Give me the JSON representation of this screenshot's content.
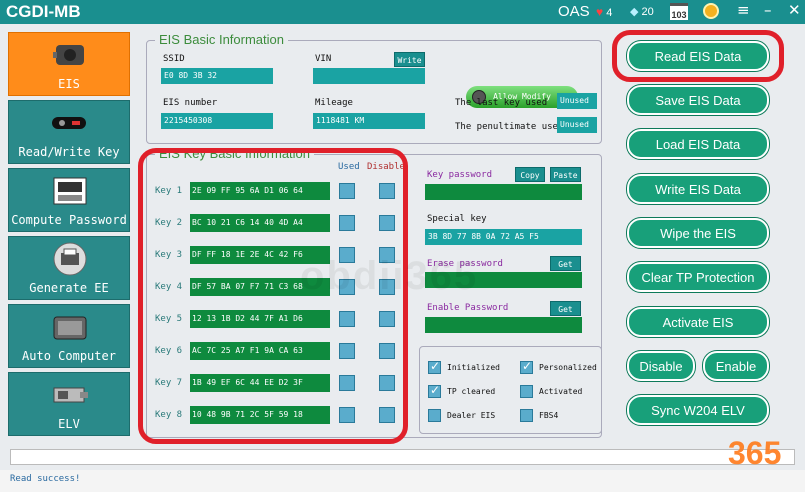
{
  "app": {
    "title": "CGDI-MB",
    "oas": "OAS",
    "hearts": "4",
    "diamonds": "20",
    "calendar": "103"
  },
  "sidebar": {
    "items": [
      {
        "label": "EIS",
        "icon": "eis-icon",
        "active": true
      },
      {
        "label": "Read/Write Key",
        "icon": "car-key-icon"
      },
      {
        "label": "Compute Password",
        "icon": "keyboard-icon"
      },
      {
        "label": "Generate EE",
        "icon": "printer-icon"
      },
      {
        "label": "Auto Computer",
        "icon": "ecu-icon"
      },
      {
        "label": "ELV",
        "icon": "elv-icon"
      }
    ]
  },
  "eis_basic": {
    "title": "EIS Basic Information",
    "ssid_label": "SSID",
    "ssid": "E0 8D 3B 32",
    "vin_label": "VIN",
    "vin": "",
    "write_label": "Write",
    "allow_modify": "Allow Modify",
    "eis_number_label": "EIS number",
    "eis_number": "2215450308",
    "mileage_label": "Mileage",
    "mileage": "1118481 KM",
    "last_key_label": "The last key used",
    "last_key": "Unused",
    "penultimate_label": "The penultimate used",
    "penultimate": "Unused"
  },
  "eis_key": {
    "title": "EIS Key Basic Information",
    "used_header": "Used",
    "disable_header": "Disable",
    "keys": [
      {
        "label": "Key 1",
        "value": "2E 09 FF 95 6A D1 06 64"
      },
      {
        "label": "Key 2",
        "value": "BC 10 21 C6 14 40 4D A4"
      },
      {
        "label": "Key 3",
        "value": "DF FF 18 1E 2E 4C 42 F6"
      },
      {
        "label": "Key 4",
        "value": "DF 57 BA 07 F7 71 C3 68"
      },
      {
        "label": "Key 5",
        "value": "12 13 1B D2 44 7F A1 D6"
      },
      {
        "label": "Key 6",
        "value": "AC 7C 25 A7 F1 9A CA 63"
      },
      {
        "label": "Key 7",
        "value": "1B 49 EF 6C 44 EE D2 3F"
      },
      {
        "label": "Key 8",
        "value": "10 48 9B 71 2C 5F 59 18"
      }
    ],
    "key_password_label": "Key password",
    "key_password": "",
    "copy_label": "Copy",
    "paste_label": "Paste",
    "special_key_label": "Special key",
    "special_key": "3B 8D 77 8B 0A 72 A5 F5",
    "erase_password_label": "Erase password",
    "erase_password": "",
    "get_label": "Get",
    "enable_password_label": "Enable Password",
    "enable_password": "",
    "options": [
      {
        "label": "Initialized",
        "checked": true
      },
      {
        "label": "Personalized",
        "checked": true
      },
      {
        "label": "TP cleared",
        "checked": true
      },
      {
        "label": "Activated",
        "checked": false
      },
      {
        "label": "Dealer EIS",
        "checked": false
      },
      {
        "label": "FBS4",
        "checked": false
      }
    ]
  },
  "actions": {
    "read": "Read  EIS Data",
    "save": "Save EIS Data",
    "load": "Load EIS Data",
    "write": "Write EIS Data",
    "wipe": "Wipe the EIS",
    "clear_tp": "Clear TP Protection",
    "activate": "Activate EIS",
    "disable": "Disable",
    "enable": "Enable",
    "sync": "Sync W204 ELV"
  },
  "status": {
    "text": "Read success!"
  },
  "watermark": "obdii365",
  "watermark_logo": "365",
  "colors": {
    "accent": "#2a8a8a",
    "active": "#ff8c1a",
    "highlight": "#e0202a",
    "key_field": "#0e8a3e"
  }
}
